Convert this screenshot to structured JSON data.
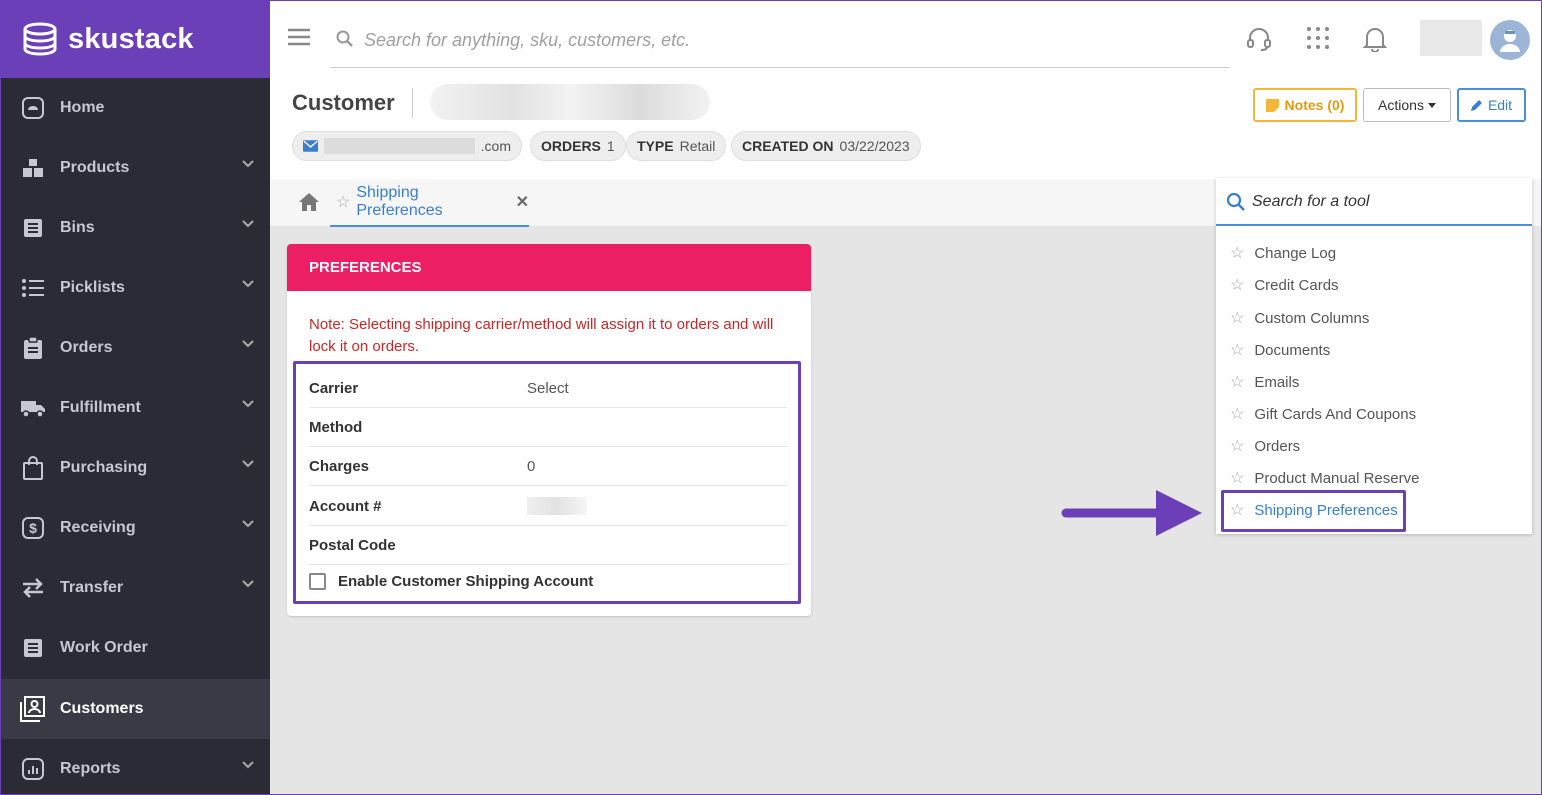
{
  "brand": {
    "name": "skustack"
  },
  "sidebar": {
    "items": [
      {
        "label": "Home",
        "icon": "home-icon",
        "chevron": false
      },
      {
        "label": "Products",
        "icon": "boxes-icon",
        "chevron": true
      },
      {
        "label": "Bins",
        "icon": "list-box-icon",
        "chevron": true
      },
      {
        "label": "Picklists",
        "icon": "list-icon",
        "chevron": true
      },
      {
        "label": "Orders",
        "icon": "clipboard-icon",
        "chevron": true
      },
      {
        "label": "Fulfillment",
        "icon": "truck-icon",
        "chevron": true
      },
      {
        "label": "Purchasing",
        "icon": "shopping-bag-icon",
        "chevron": true
      },
      {
        "label": "Receiving",
        "icon": "dollar-icon",
        "chevron": true
      },
      {
        "label": "Transfer",
        "icon": "transfer-icon",
        "chevron": true
      },
      {
        "label": "Work Order",
        "icon": "work-order-icon",
        "chevron": false
      },
      {
        "label": "Customers",
        "icon": "customers-icon",
        "chevron": false,
        "active": true
      },
      {
        "label": "Reports",
        "icon": "reports-icon",
        "chevron": true
      }
    ]
  },
  "topbar": {
    "search_placeholder": "Search for anything, sku, customers, etc."
  },
  "header": {
    "title": "Customer",
    "email_suffix": ".com",
    "orders_label": "ORDERS",
    "orders_value": "1",
    "type_label": "TYPE",
    "type_value": "Retail",
    "created_label": "CREATED ON",
    "created_value": "03/22/2023",
    "notes_label": "Notes (0)",
    "actions_label": "Actions",
    "edit_label": "Edit"
  },
  "tabs": {
    "active_tab": "Shipping Preferences"
  },
  "preferences": {
    "title": "PREFERENCES",
    "note": "Note: Selecting shipping carrier/method will assign it to orders and will lock it on orders.",
    "fields": [
      {
        "label": "Carrier",
        "value": "Select"
      },
      {
        "label": "Method",
        "value": ""
      },
      {
        "label": "Charges",
        "value": "0"
      },
      {
        "label": "Account #",
        "value": ""
      },
      {
        "label": "Postal Code",
        "value": ""
      }
    ],
    "checkbox_label": "Enable Customer Shipping Account"
  },
  "tools": {
    "search_placeholder": "Search for a tool",
    "items": [
      "Change Log",
      "Credit Cards",
      "Custom Columns",
      "Documents",
      "Emails",
      "Gift Cards And Coupons",
      "Orders",
      "Product Manual Reserve",
      "Shipping Preferences"
    ]
  },
  "colors": {
    "brand": "#6a3fb8",
    "sidebar": "#2b2b36",
    "card_header": "#ec1f64",
    "link": "#3a7fcc",
    "notes": "#f4b63a"
  }
}
